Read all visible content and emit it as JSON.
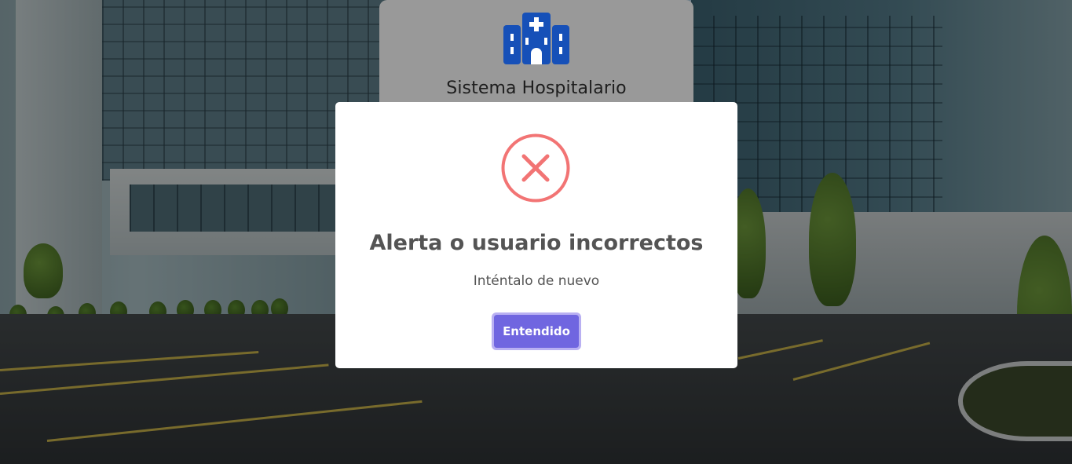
{
  "login_card": {
    "logo_icon": "hospital-icon",
    "title": "Sistema Hospitalario"
  },
  "alert": {
    "icon": "error-x-icon",
    "title": "Alerta o usuario incorrectos",
    "text": "Inténtalo de nuevo",
    "confirm_label": "Entendido"
  },
  "colors": {
    "logo_blue": "#1650b8",
    "error_red": "#f27474",
    "confirm_purple": "#7066e0"
  }
}
